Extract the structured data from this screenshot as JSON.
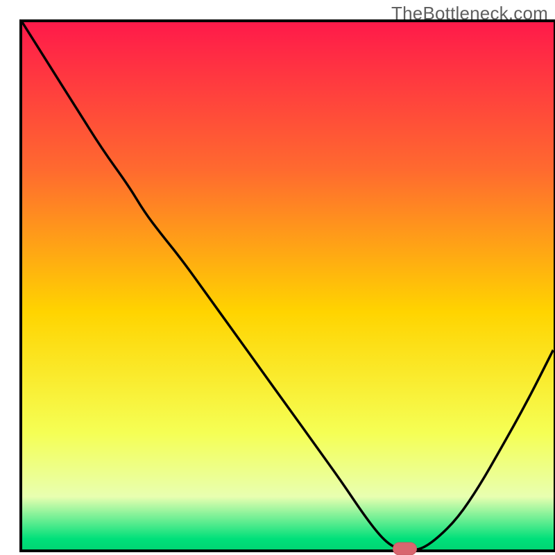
{
  "watermark": "TheBottleneck.com",
  "colors": {
    "axis": "#000000",
    "curve": "#000000",
    "marker_fill": "#d9666f",
    "marker_stroke": "#c85a63",
    "gradient_top": "#ff1a4a",
    "gradient_mid_upper": "#ff8a2a",
    "gradient_mid": "#ffd400",
    "gradient_lower": "#f7ff6a",
    "gradient_pale": "#eeffb0",
    "gradient_bottom": "#00e07a"
  },
  "chart_data": {
    "type": "line",
    "title": "",
    "xlabel": "",
    "ylabel": "",
    "xlim": [
      0,
      100
    ],
    "ylim": [
      0,
      100
    ],
    "x": [
      0,
      5,
      10,
      15,
      20,
      23,
      26,
      30,
      35,
      40,
      45,
      50,
      55,
      60,
      64,
      67,
      69,
      71,
      73,
      75,
      78,
      82,
      86,
      90,
      95,
      100
    ],
    "values": [
      100,
      92,
      84,
      76,
      69,
      64,
      60,
      55,
      48,
      41,
      34,
      27,
      20,
      13,
      7,
      3,
      1,
      0,
      0,
      0,
      2,
      6,
      12,
      19,
      28,
      38
    ],
    "marker": {
      "x": 72,
      "y": 0
    },
    "note": "x and y are normalized 0–100; axes are unlabeled in the source image so units are unknown. Values are visually estimated from the curve against the frame."
  }
}
